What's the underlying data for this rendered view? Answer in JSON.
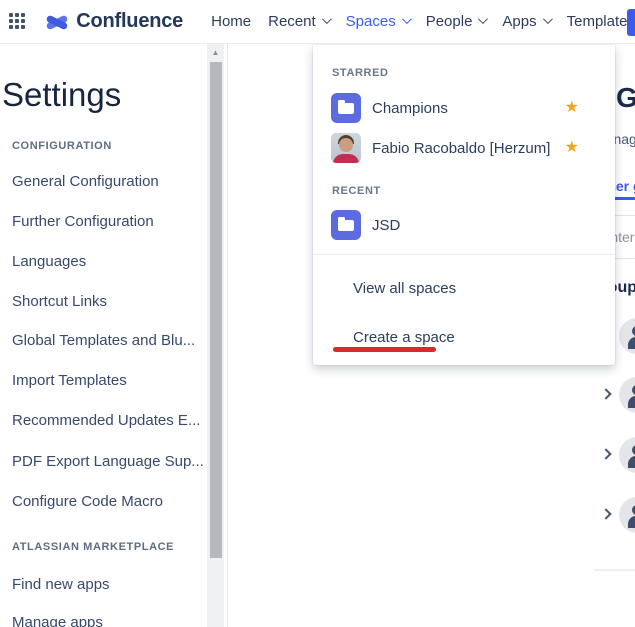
{
  "navbar": {
    "product": "Confluence",
    "items": [
      {
        "label": "Home",
        "has_dropdown": false,
        "active": false
      },
      {
        "label": "Recent",
        "has_dropdown": true,
        "active": false
      },
      {
        "label": "Spaces",
        "has_dropdown": true,
        "active": true
      },
      {
        "label": "People",
        "has_dropdown": true,
        "active": false
      },
      {
        "label": "Apps",
        "has_dropdown": true,
        "active": false
      },
      {
        "label": "Templates",
        "has_dropdown": false,
        "active": false
      }
    ],
    "accent_color": "#3B5CE8"
  },
  "sidebar": {
    "title": "Settings",
    "sections": [
      {
        "label": "CONFIGURATION",
        "items": [
          "General Configuration",
          "Further Configuration",
          "Languages",
          "Shortcut Links",
          "Global Templates and Blu...",
          "Import Templates",
          "Recommended Updates E...",
          "PDF Export Language Sup...",
          "Configure Code Macro"
        ]
      },
      {
        "label": "ATLASSIAN MARKETPLACE",
        "items": [
          "Find new apps",
          "Manage apps"
        ]
      }
    ]
  },
  "spaces_menu": {
    "starred_label": "STARRED",
    "recent_label": "RECENT",
    "starred": [
      {
        "name": "Champions",
        "icon": "space-folder-icon",
        "starred": true
      },
      {
        "name": "Fabio Racobaldo [Herzum]",
        "icon": "user-photo-avatar",
        "starred": true
      }
    ],
    "recent": [
      {
        "name": "JSD",
        "icon": "space-folder-icon"
      }
    ],
    "actions": [
      {
        "label": "View all spaces"
      },
      {
        "label": "Create a space",
        "annotated": true
      }
    ],
    "star_color": "#F0A622",
    "annotation_color": "#D92B2B"
  },
  "background_page": {
    "heading": "Groups",
    "description": "Manage groups",
    "active_tab": "User groups",
    "search_placeholder": "Enter group name",
    "section_header": "Groups",
    "row_count": 4
  }
}
